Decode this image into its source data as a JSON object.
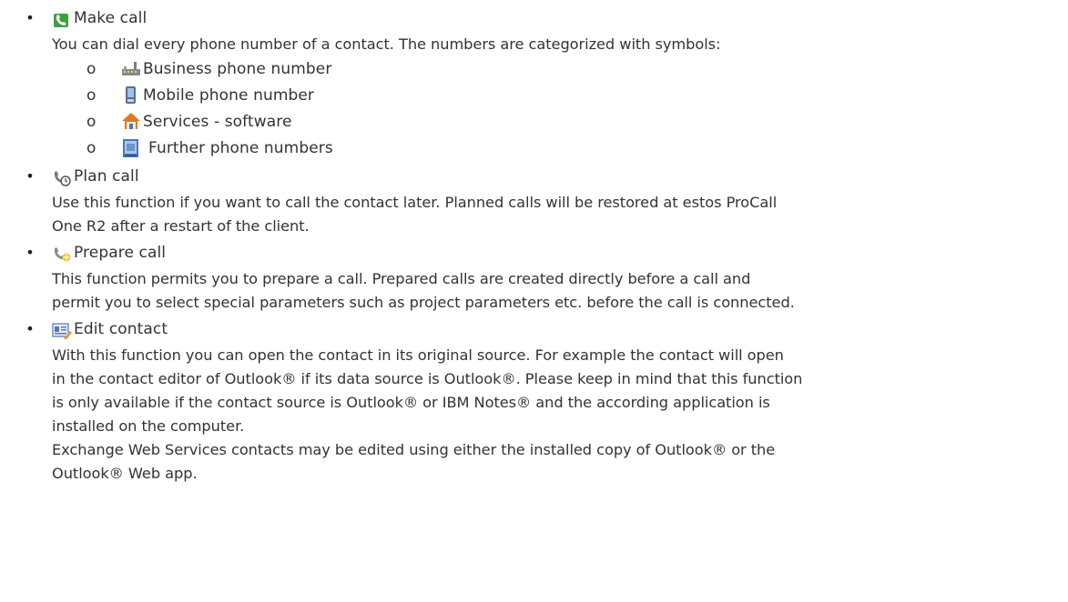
{
  "colors": {
    "text": "#333333",
    "phone_green": "#3aa23a",
    "house_orange": "#e07a1f",
    "device_blue": "#4a79b8"
  },
  "items": [
    {
      "icon": "green-phone-icon",
      "title": "Make call",
      "lines": [
        "You can dial every phone number of a contact. The numbers are categorized with symbols:"
      ],
      "subitems": [
        {
          "marker": "o",
          "icon": "factory-icon",
          "label": "Business phone number"
        },
        {
          "marker": "o",
          "icon": "mobile-phone-icon",
          "label": "Mobile phone number"
        },
        {
          "marker": "o",
          "icon": "house-icon",
          "label": "Services - software"
        },
        {
          "marker": "o",
          "icon": "contact-card-icon",
          "label": "Further phone numbers"
        }
      ]
    },
    {
      "icon": "phone-clock-icon",
      "title": "Plan call",
      "lines": [
        "Use this function if you want to call the contact later. Planned calls will be restored at estos ProCall",
        "One R2 after a restart of the client."
      ]
    },
    {
      "icon": "phone-star-icon",
      "title": "Prepare call",
      "lines": [
        "This function permits you to prepare a call. Prepared calls are created directly before a call and",
        "permit you to select special parameters such as project parameters etc. before the call is connected."
      ]
    },
    {
      "icon": "edit-contact-icon",
      "title": "Edit contact",
      "lines": [
        "With this function you can open the contact in its original source. For example the contact will open",
        "in the contact editor of Outlook® if its data source is Outlook®. Please keep in mind that this function",
        "is only available if the contact source is Outlook® or IBM Notes® and the according application is",
        "installed on the computer.",
        "Exchange Web Services contacts may be edited using either the installed copy of Outlook® or the",
        "Outlook® Web app."
      ]
    }
  ],
  "bullet": "•"
}
